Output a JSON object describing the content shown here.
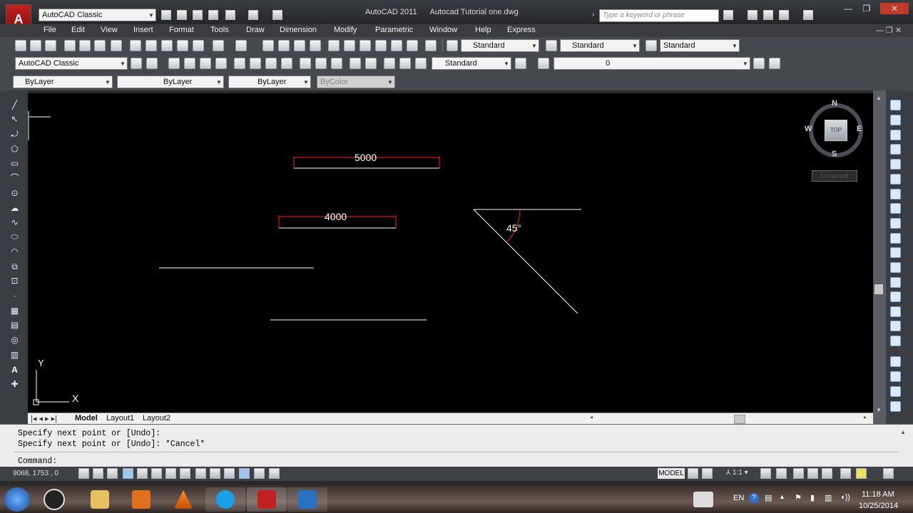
{
  "title_bar": {
    "workspace_combo": "AutoCAD Classic",
    "app_name": "AutoCAD 2011",
    "document_name": "Autocad Tutorial one.dwg",
    "search_placeholder": "Type a keyword or phrase",
    "minimize": "—",
    "maximize": "❐",
    "close": "✕"
  },
  "menu": {
    "items": [
      "File",
      "Edit",
      "View",
      "Insert",
      "Format",
      "Tools",
      "Draw",
      "Dimension",
      "Modify",
      "Parametric",
      "Window",
      "Help",
      "Express"
    ]
  },
  "toolbar1": {
    "text_style": "Standard",
    "dim_style": "Standard",
    "table_style": "Standard"
  },
  "toolbar2": {
    "workspace": "AutoCAD Classic",
    "multileader_style": "Standard",
    "layer": "0"
  },
  "toolbar3": {
    "color": "ByLayer",
    "linetype": "ByLayer",
    "lineweight": "ByLayer",
    "plot_style": "ByColor"
  },
  "viewcube": {
    "north": "N",
    "south": "S",
    "east": "E",
    "west": "W",
    "face": "TOP",
    "ucs_name": "Unnamed"
  },
  "drawing": {
    "dim1": "5000",
    "dim2": "4000",
    "angle": "45°",
    "ucs_y": "Y",
    "ucs_x": "X"
  },
  "layout_tabs": [
    "Model",
    "Layout1",
    "Layout2"
  ],
  "command": {
    "history": [
      "Specify next point or [Undo]:",
      "Specify next point or [Undo]: *Cancel*"
    ],
    "prompt": "Command:"
  },
  "status": {
    "coordinates": "9068, 1753 , 0",
    "space": "MODEL",
    "annotation_scale": "1:1"
  },
  "taskbar": {
    "language": "EN",
    "time": "11:18 AM",
    "date": "10/25/2014"
  },
  "colors": {
    "canvas": "#000000",
    "dimension": "#ff2020",
    "geometry": "#ffffff"
  }
}
